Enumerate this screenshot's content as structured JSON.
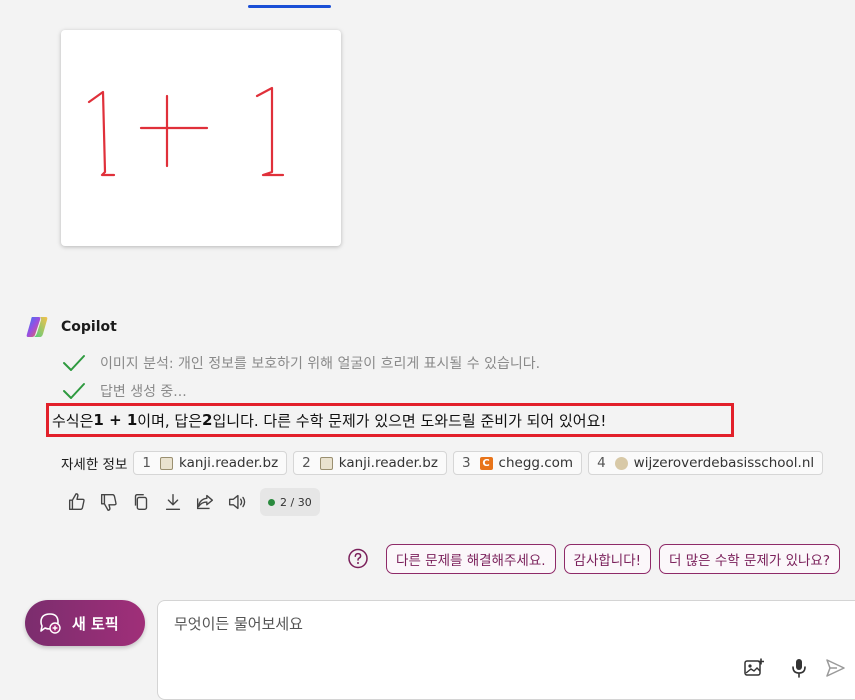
{
  "uploaded_image": {
    "handwritten_text": "1 + 1"
  },
  "assistant": {
    "name": "Copilot",
    "status_lines": [
      "이미지 분석: 개인 정보를 보호하기 위해 얼굴이 흐리게 표시될 수 있습니다.",
      "답변 생성 중..."
    ],
    "answer": {
      "part1": "수식은 ",
      "expr": "1 + 1",
      "part2": " 이며, 답은 ",
      "result": "2",
      "part3": " 입니다. 다른 수학 문제가 있으면 도와드릴 준비가 되어 있어요!"
    },
    "answer_highlight_color": "#e2202a"
  },
  "sources": {
    "label": "자세한 정보",
    "items": [
      {
        "num": "1",
        "site": "kanji.reader.bz",
        "favicon": "kanji-reader-favicon"
      },
      {
        "num": "2",
        "site": "kanji.reader.bz",
        "favicon": "kanji-reader-favicon"
      },
      {
        "num": "3",
        "site": "chegg.com",
        "favicon": "chegg-favicon"
      },
      {
        "num": "4",
        "site": "wijzeroverdebasisschool.nl",
        "favicon": "wijzer-favicon"
      }
    ]
  },
  "actions": {
    "icons": [
      "thumbs-up-icon",
      "thumbs-down-icon",
      "copy-icon",
      "download-icon",
      "share-icon",
      "read-aloud-icon"
    ],
    "turn_count": "2 / 30"
  },
  "suggestions": {
    "items": [
      "다른 문제를 해결해주세요.",
      "감사합니다!",
      "더 많은 수학 문제가 있나요?"
    ]
  },
  "composer": {
    "new_topic_label": "새 토픽",
    "placeholder": "무엇이든 물어보세요"
  },
  "colors": {
    "accent_blue": "#1a4fd6",
    "brand_purple": "#8e2a68",
    "handwriting_red": "#e0303a"
  }
}
